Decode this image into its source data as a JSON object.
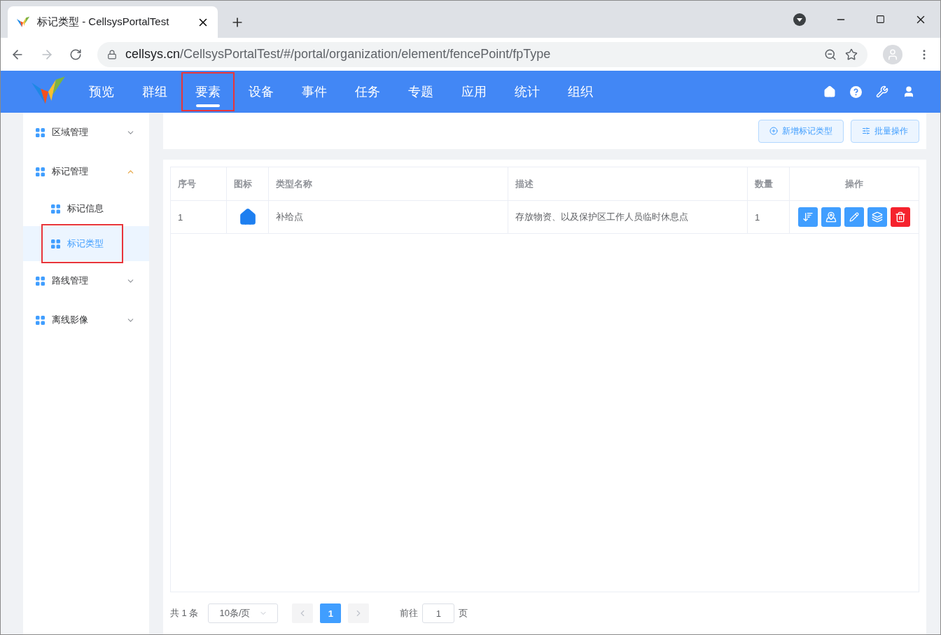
{
  "browser": {
    "tab_title": "标记类型 - CellsysPortalTest",
    "url_host": "cellsys.cn",
    "url_path": "/CellsysPortalTest/#/portal/organization/element/fencePoint/fpType"
  },
  "nav": {
    "items": [
      {
        "label": "预览",
        "selected": false,
        "highlighted": false
      },
      {
        "label": "群组",
        "selected": false,
        "highlighted": false
      },
      {
        "label": "要素",
        "selected": true,
        "highlighted": true
      },
      {
        "label": "设备",
        "selected": false,
        "highlighted": false
      },
      {
        "label": "事件",
        "selected": false,
        "highlighted": false
      },
      {
        "label": "任务",
        "selected": false,
        "highlighted": false
      },
      {
        "label": "专题",
        "selected": false,
        "highlighted": false
      },
      {
        "label": "应用",
        "selected": false,
        "highlighted": false
      },
      {
        "label": "统计",
        "selected": false,
        "highlighted": false
      },
      {
        "label": "组织",
        "selected": false,
        "highlighted": false
      }
    ]
  },
  "sidebar": {
    "items": [
      {
        "label": "区域管理",
        "expanded": false
      },
      {
        "label": "标记管理",
        "expanded": true,
        "children": [
          {
            "label": "标记信息",
            "selected": false,
            "highlighted": false
          },
          {
            "label": "标记类型",
            "selected": true,
            "highlighted": true
          }
        ]
      },
      {
        "label": "路线管理",
        "expanded": false
      },
      {
        "label": "离线影像",
        "expanded": false
      }
    ]
  },
  "toolbar": {
    "buttons": [
      {
        "kind": "add",
        "label": "新增标记类型"
      },
      {
        "kind": "batch",
        "label": "批量操作"
      }
    ]
  },
  "table": {
    "columns": [
      "序号",
      "图标",
      "类型名称",
      "描述",
      "数量",
      "操作"
    ],
    "rows": [
      {
        "index": "1",
        "name": "补给点",
        "description": "存放物资、以及保护区工作人员临时休息点",
        "count": "1",
        "actions": [
          {
            "kind": "sort"
          },
          {
            "kind": "map"
          },
          {
            "kind": "edit"
          },
          {
            "kind": "layers"
          },
          {
            "kind": "delete"
          }
        ]
      }
    ]
  },
  "pagination": {
    "total": "共 1 条",
    "page_size": "10条/页",
    "pages": [
      {
        "label": "1",
        "selected": true
      }
    ],
    "goto_label": "前往",
    "goto_value": "1",
    "page_suffix": "页"
  }
}
